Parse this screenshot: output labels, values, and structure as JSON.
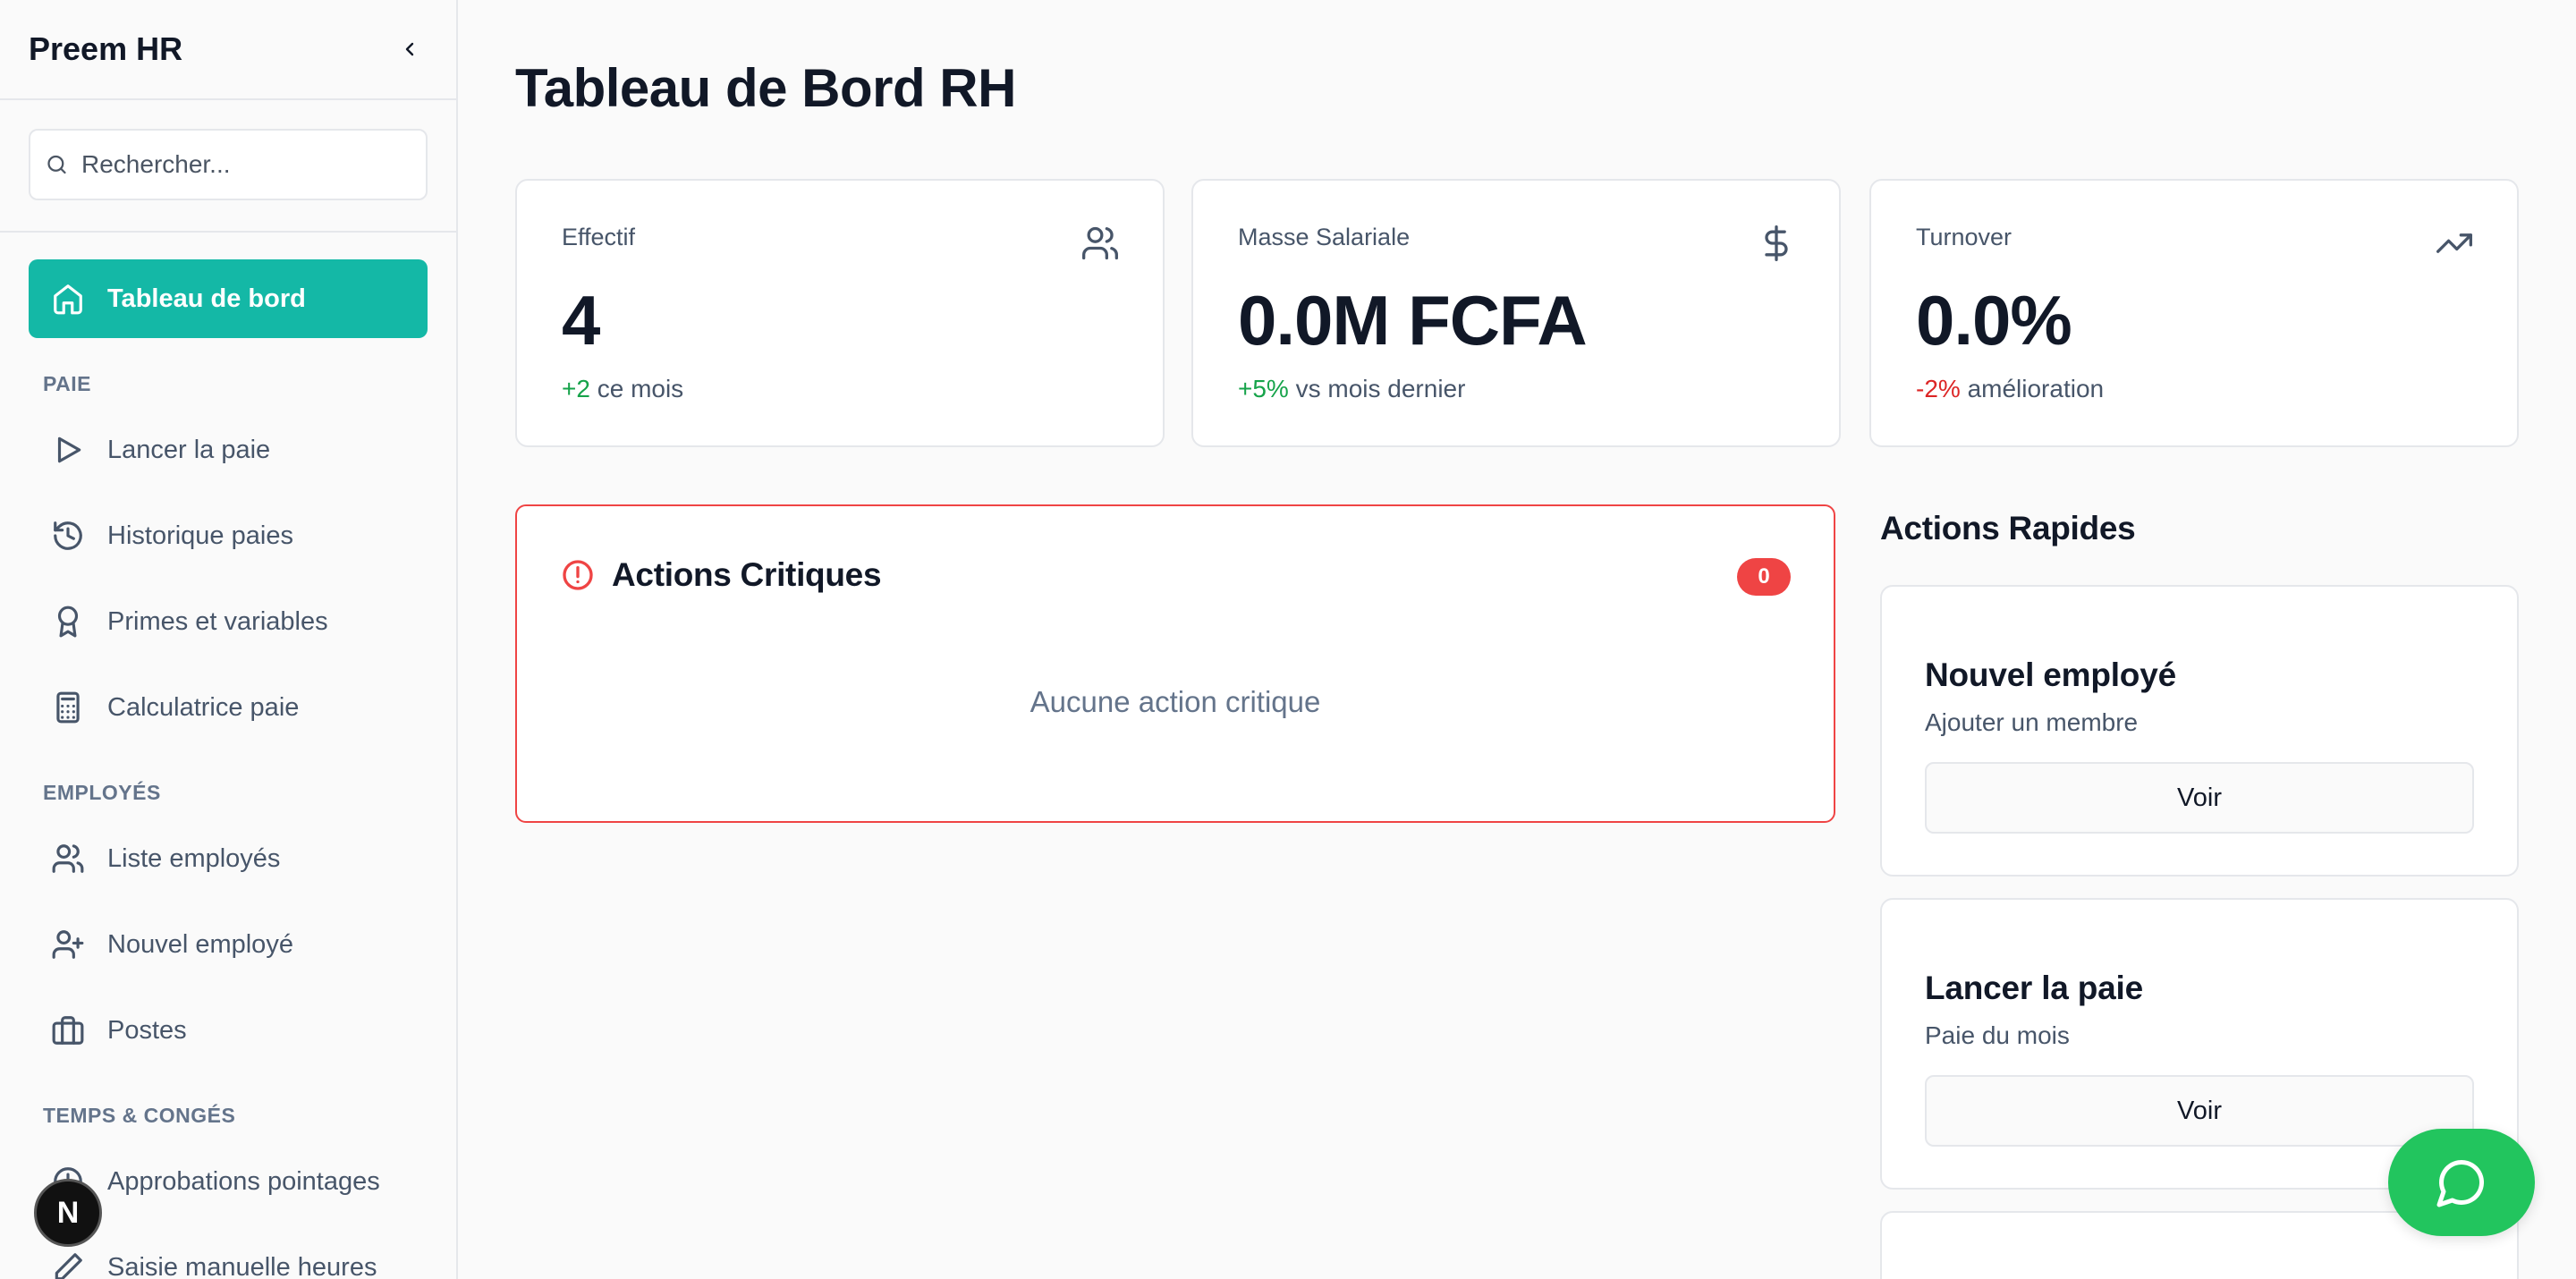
{
  "app": {
    "brand": "Preem HR"
  },
  "search": {
    "placeholder": "Rechercher..."
  },
  "sidebar": {
    "dashboard": "Tableau de bord",
    "sections": {
      "paie": "PAIE",
      "employes": "EMPLOYÉS",
      "temps": "TEMPS & CONGÉS"
    },
    "paie_items": [
      "Lancer la paie",
      "Historique paies",
      "Primes et variables",
      "Calculatrice paie"
    ],
    "employes_items": [
      "Liste employés",
      "Nouvel employé",
      "Postes"
    ],
    "temps_items": [
      "Approbations pointages",
      "Saisie manuelle heures"
    ]
  },
  "page": {
    "title": "Tableau de Bord RH"
  },
  "stats": [
    {
      "label": "Effectif",
      "value": "4",
      "delta": "+2",
      "delta_text": " ce mois",
      "icon": "users-icon"
    },
    {
      "label": "Masse Salariale",
      "value": "0.0M FCFA",
      "delta": "+5%",
      "delta_text": " vs mois dernier",
      "icon": "dollar-icon"
    },
    {
      "label": "Turnover",
      "value": "0.0%",
      "delta": "-2%",
      "delta_text": " amélioration",
      "icon": "trending-up-icon"
    }
  ],
  "critical": {
    "title": "Actions Critiques",
    "count": "0",
    "empty": "Aucune action critique"
  },
  "quick_actions": {
    "title": "Actions Rapides",
    "items": [
      {
        "name": "Nouvel employé",
        "desc": "Ajouter un membre",
        "button": "Voir"
      },
      {
        "name": "Lancer la paie",
        "desc": "Paie du mois",
        "button": "Voir"
      }
    ]
  },
  "dev_badge": "N",
  "colors": {
    "accent": "#14b8a6",
    "positive": "#16a34a",
    "negative": "#dc2626",
    "critical": "#ef4444",
    "chat": "#22c55e"
  }
}
